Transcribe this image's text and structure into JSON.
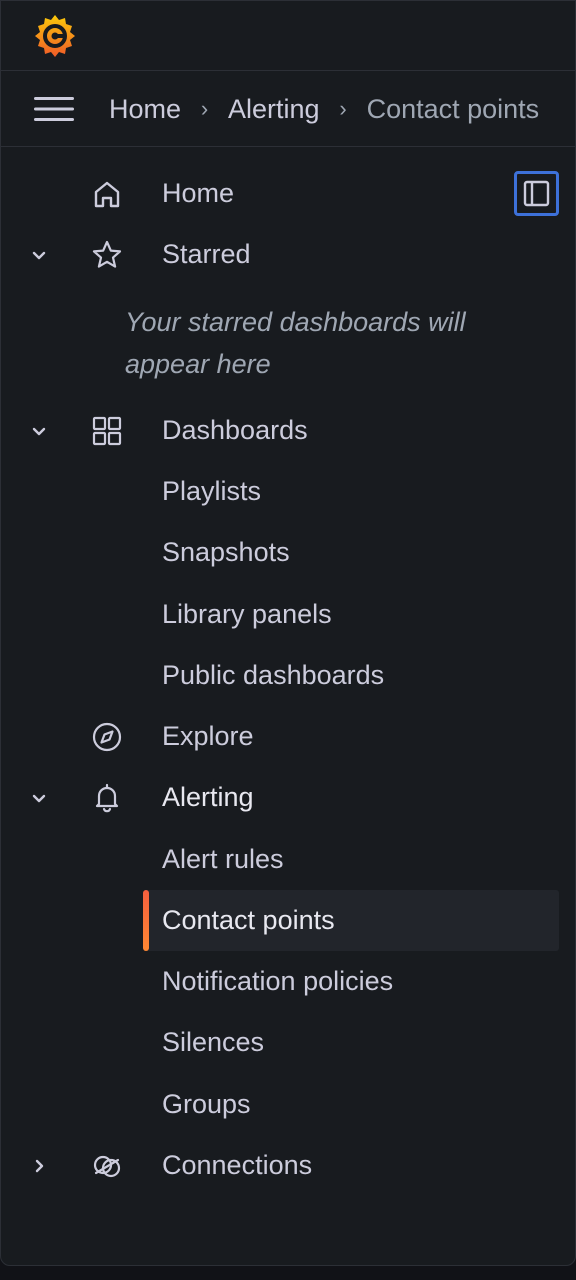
{
  "brand": {
    "logo_icon": "grafana-logo-icon",
    "accent": "#f55f3e"
  },
  "breadcrumb": {
    "items": [
      {
        "label": "Home"
      },
      {
        "label": "Alerting"
      },
      {
        "label": "Contact points"
      }
    ],
    "separator": "›"
  },
  "sidebar": {
    "empty_starred_text": "Your starred dashboards will appear here",
    "dock_button_icon": "dock-menu-icon",
    "items": [
      {
        "label": "Home",
        "icon": "home-icon"
      },
      {
        "label": "Starred",
        "icon": "star-icon",
        "expanded": true
      },
      {
        "label": "Dashboards",
        "icon": "apps-icon",
        "expanded": true
      },
      {
        "label": "Playlists"
      },
      {
        "label": "Snapshots"
      },
      {
        "label": "Library panels"
      },
      {
        "label": "Public dashboards"
      },
      {
        "label": "Explore",
        "icon": "compass-icon"
      },
      {
        "label": "Alerting",
        "icon": "bell-icon",
        "expanded": true
      },
      {
        "label": "Alert rules"
      },
      {
        "label": "Contact points",
        "active": true
      },
      {
        "label": "Notification policies"
      },
      {
        "label": "Silences"
      },
      {
        "label": "Groups"
      },
      {
        "label": "Connections",
        "icon": "connections-icon",
        "expanded": false
      }
    ]
  }
}
